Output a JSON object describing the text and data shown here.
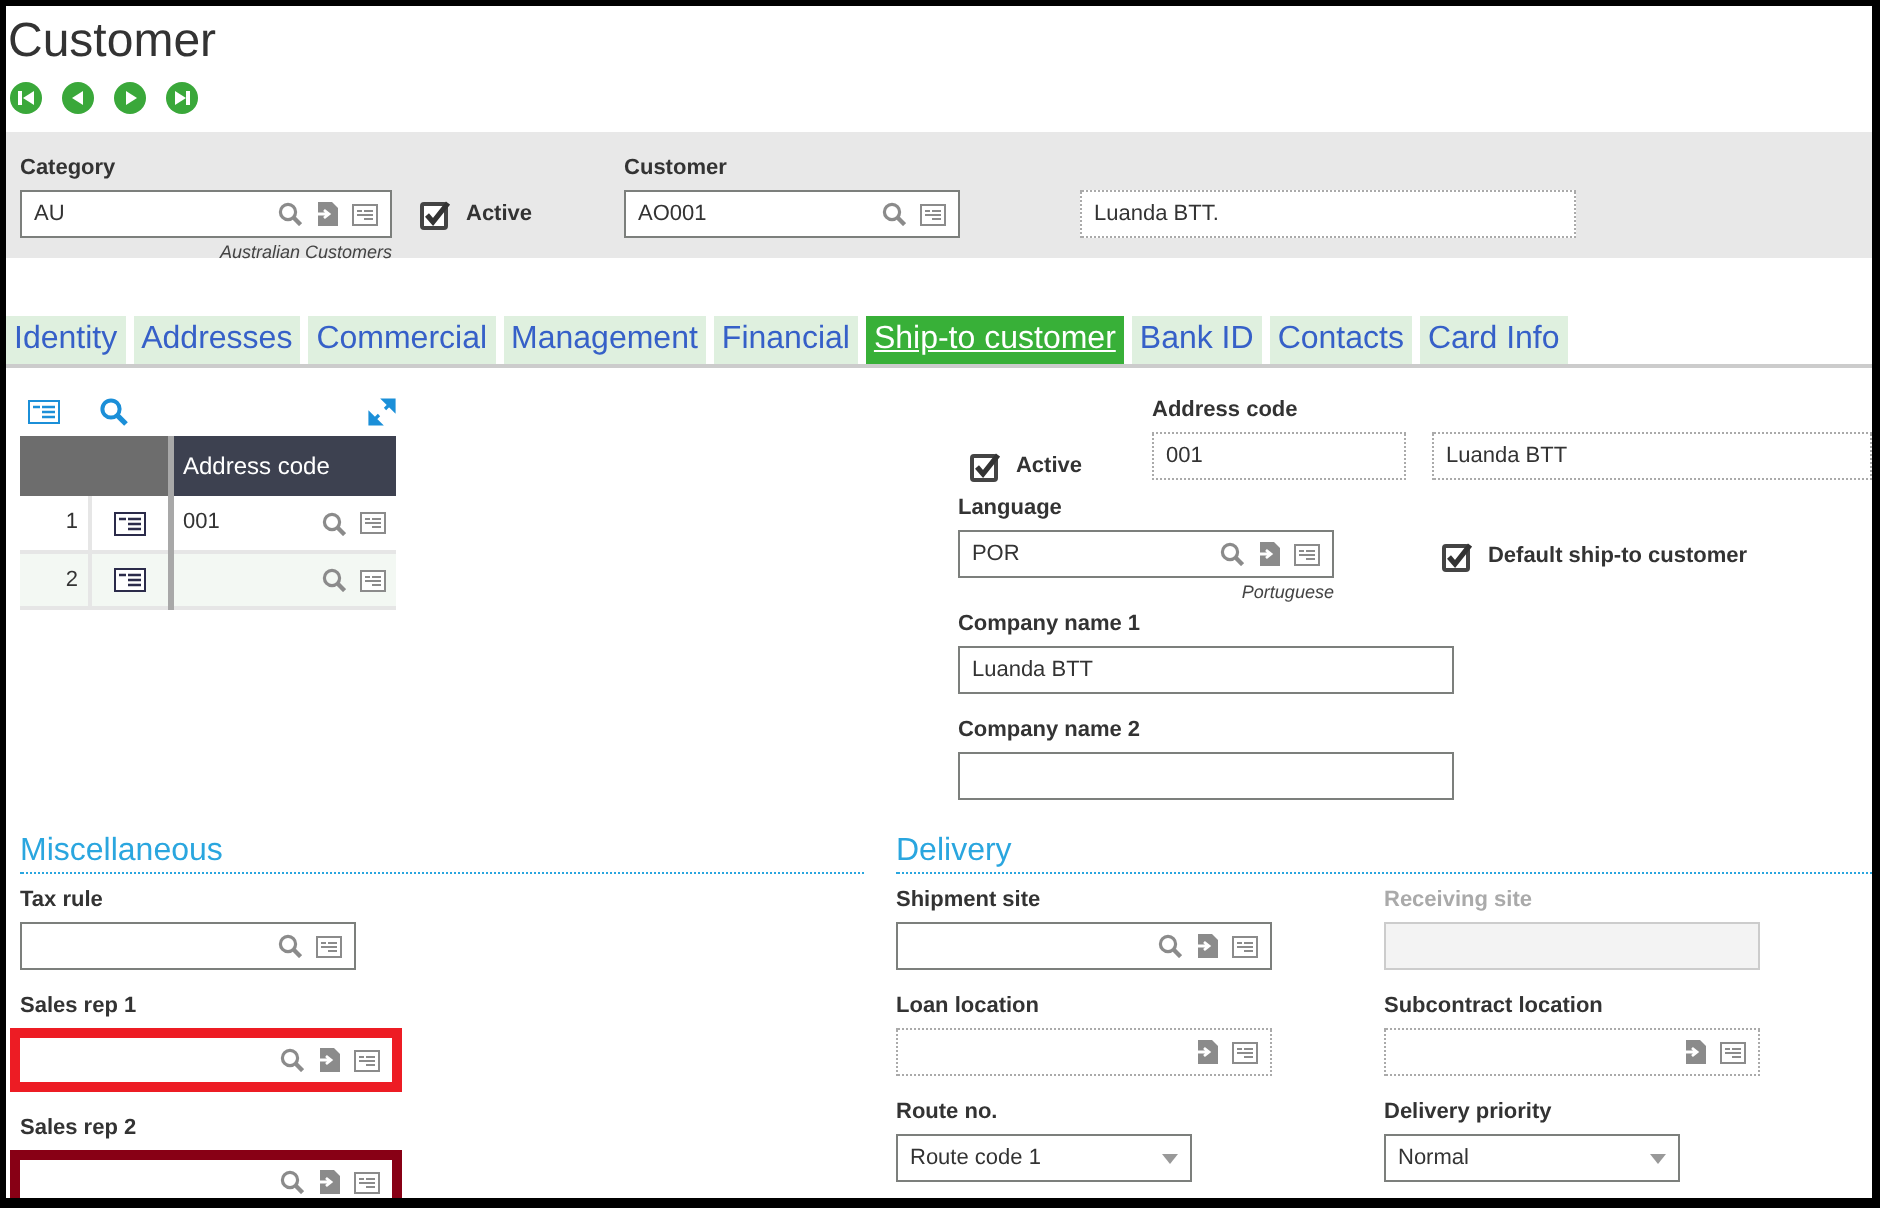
{
  "title": "Customer",
  "header": {
    "category": {
      "label": "Category",
      "value": "AU",
      "note": "Australian Customers",
      "kind": "search-jump-detail"
    },
    "active": {
      "label": "Active",
      "checked": true
    },
    "customer": {
      "label": "Customer",
      "value": "AO001",
      "kind": "search-detail"
    },
    "customer_name": {
      "value": "Luanda BTT.",
      "kind": "readonly"
    }
  },
  "tabs": [
    {
      "label": "Identity",
      "selected": false
    },
    {
      "label": "Addresses",
      "selected": false
    },
    {
      "label": "Commercial",
      "selected": false
    },
    {
      "label": "Management",
      "selected": false
    },
    {
      "label": "Financial",
      "selected": false
    },
    {
      "label": "Ship-to customer",
      "selected": true
    },
    {
      "label": "Bank ID",
      "selected": false
    },
    {
      "label": "Contacts",
      "selected": false
    },
    {
      "label": "Card Info",
      "selected": false
    }
  ],
  "address_table": {
    "columns": [
      "Address code"
    ],
    "rows": [
      {
        "number": "1",
        "address_code": "001"
      },
      {
        "number": "2"
      }
    ]
  },
  "ship_to": {
    "active": {
      "label": "Active",
      "checked": true
    },
    "address_code": {
      "label": "Address code",
      "value": "001",
      "kind": "readonly"
    },
    "address_name": {
      "value": "Luanda BTT",
      "kind": "readonly"
    },
    "language": {
      "label": "Language",
      "value": "POR",
      "note": "Portuguese",
      "kind": "search-jump-detail"
    },
    "default_ship_to": {
      "label": "Default ship-to customer",
      "checked": true
    },
    "company_name_1": {
      "label": "Company name 1",
      "value": "Luanda BTT",
      "kind": "text"
    },
    "company_name_2": {
      "label": "Company name 2",
      "kind": "text"
    }
  },
  "miscellaneous": {
    "title": "Miscellaneous",
    "fields": [
      {
        "label": "Tax rule",
        "kind": "search-detail"
      },
      {
        "label": "Sales rep 1",
        "kind": "search-jump-detail",
        "color": "#ed1c24"
      },
      {
        "label": "Sales rep 2",
        "kind": "search-jump-detail",
        "color": "#880015"
      }
    ]
  },
  "delivery": {
    "title": "Delivery",
    "fields": [
      {
        "label": "Shipment site",
        "kind": "search-jump-detail"
      },
      {
        "label": "Receiving site",
        "kind": "disabled"
      },
      {
        "label": "Loan location",
        "kind": "readonly-jump-detail"
      },
      {
        "label": "Subcontract location",
        "kind": "readonly-jump-detail"
      },
      {
        "label": "Route no.",
        "value": "Route code 1",
        "kind": "select"
      },
      {
        "label": "Delivery priority",
        "value": "Normal",
        "kind": "select"
      }
    ]
  }
}
